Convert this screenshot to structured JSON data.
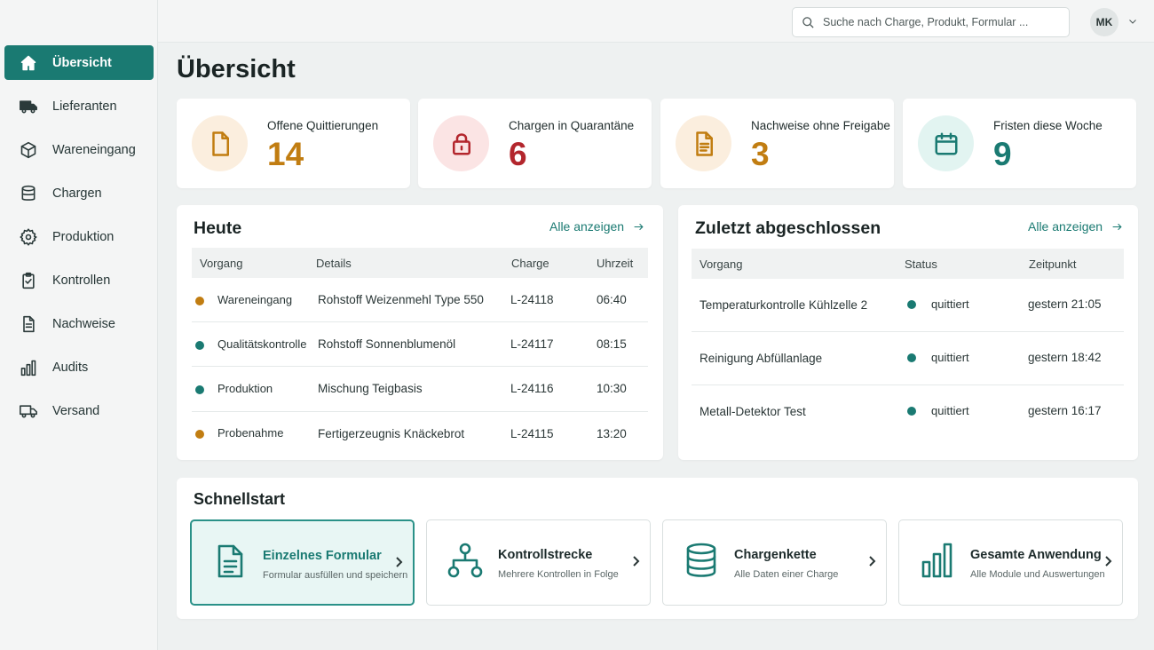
{
  "sidebar": {
    "items": [
      {
        "label": "Übersicht",
        "icon": "home-icon",
        "active": true
      },
      {
        "label": "Lieferanten",
        "icon": "truck-icon"
      },
      {
        "label": "Wareneingang",
        "icon": "package-icon"
      },
      {
        "label": "Chargen",
        "icon": "database-icon"
      },
      {
        "label": "Produktion",
        "icon": "gear-icon"
      },
      {
        "label": "Kontrollen",
        "icon": "clipboard-check-icon"
      },
      {
        "label": "Nachweise",
        "icon": "document-icon"
      },
      {
        "label": "Audits",
        "icon": "bar-chart-icon"
      },
      {
        "label": "Versand",
        "icon": "delivery-truck-icon"
      }
    ]
  },
  "topbar": {
    "search_placeholder": "Suche nach Charge, Produkt, Formular ...",
    "avatar_initials": "MK"
  },
  "page": {
    "title": "Übersicht"
  },
  "kpis": [
    {
      "label": "Offene Quittierungen",
      "value": "14",
      "icon": "document-icon",
      "color": "#c17d11",
      "bg": "#fbeede"
    },
    {
      "label": "Chargen in Quarantäne",
      "value": "6",
      "icon": "lock-icon",
      "color": "#b3262d",
      "bg": "#fbe4e4"
    },
    {
      "label": "Nachweise ohne Freigabe",
      "value": "3",
      "icon": "document-lines-icon",
      "color": "#c17d11",
      "bg": "#fbeede"
    },
    {
      "label": "Fristen diese Woche",
      "value": "9",
      "icon": "calendar-icon",
      "color": "#1a7a72",
      "bg": "#e2f4f1"
    }
  ],
  "today": {
    "title": "Heute",
    "link": "Alle anzeigen",
    "columns": [
      "Vorgang",
      "Details",
      "Charge",
      "Uhrzeit"
    ],
    "rows": [
      {
        "vorgang": "Wareneingang",
        "details": "Rohstoff Weizenmehl Type 550",
        "charge": "L-24118",
        "zeit": "06:40",
        "dot": "#c17d11"
      },
      {
        "vorgang": "Qualitätskontrolle",
        "details": "Rohstoff Sonnenblumenöl",
        "charge": "L-24117",
        "zeit": "08:15",
        "dot": "#1a7a72"
      },
      {
        "vorgang": "Produktion",
        "details": "Mischung Teigbasis",
        "charge": "L-24116",
        "zeit": "10:30",
        "dot": "#1a7a72"
      },
      {
        "vorgang": "Probenahme",
        "details": "Fertigerzeugnis Knäckebrot",
        "charge": "L-24115",
        "zeit": "13:20",
        "dot": "#c17d11"
      }
    ]
  },
  "recent": {
    "title": "Zuletzt abgeschlossen",
    "link": "Alle anzeigen",
    "columns": [
      "Vorgang",
      "Status",
      "Zeitpunkt"
    ],
    "rows": [
      {
        "vorgang": "Temperaturkontrolle Kühlzelle 2",
        "status": "quittiert",
        "zeit": "gestern 21:05"
      },
      {
        "vorgang": "Reinigung Abfüllanlage",
        "status": "quittiert",
        "zeit": "gestern 18:42"
      },
      {
        "vorgang": "Metall-Detektor Test",
        "status": "quittiert",
        "zeit": "gestern 16:17"
      }
    ],
    "status_color": "#1a7a72"
  },
  "quickstart": {
    "title": "Schnellstart",
    "items": [
      {
        "title": "Einzelnes Formular",
        "desc": "Formular ausfüllen und speichern",
        "icon": "form-icon",
        "active": true
      },
      {
        "title": "Kontrollstrecke",
        "desc": "Mehrere Kontrollen in Folge",
        "icon": "workflow-icon"
      },
      {
        "title": "Chargenkette",
        "desc": "Alle Daten einer Charge",
        "icon": "database-icon"
      },
      {
        "title": "Gesamte Anwendung",
        "desc": "Alle Module und Auswertungen",
        "icon": "bar-chart-icon"
      }
    ]
  },
  "colors": {
    "accent": "#1a7a72",
    "warning": "#c17d11",
    "danger": "#b3262d"
  }
}
